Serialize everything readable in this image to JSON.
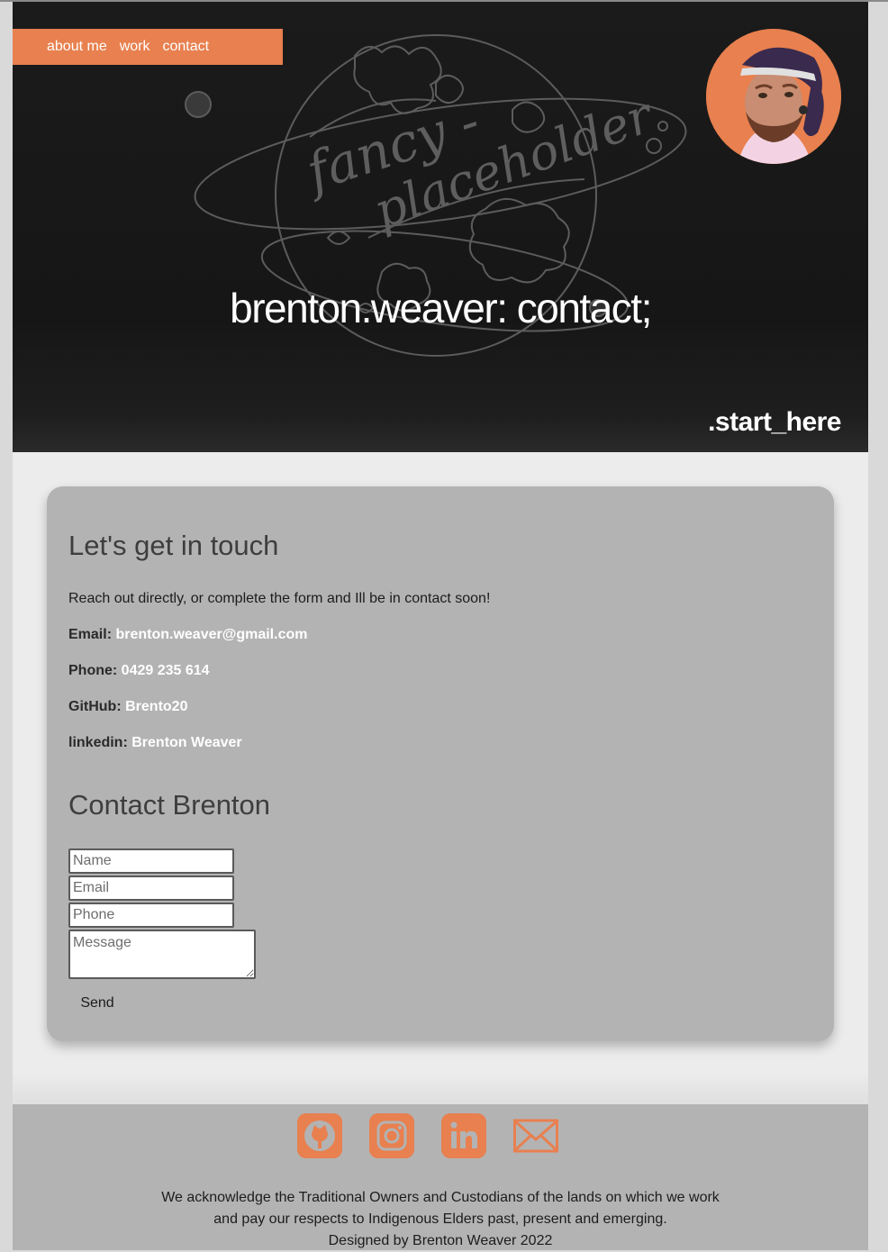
{
  "nav": {
    "items": [
      {
        "label": "about me"
      },
      {
        "label": "work"
      },
      {
        "label": "contact"
      }
    ]
  },
  "hero": {
    "title": "brenton.weaver: contact;",
    "art_text_line1": "fancy -",
    "art_text_line2": "placeholder",
    "cta": ".start_here"
  },
  "contact_info": {
    "heading": "Let's get in touch",
    "intro": "Reach out directly, or complete the form and Ill be in contact soon!",
    "email_label": "Email:",
    "email_value": "brenton.weaver@gmail.com",
    "phone_label": "Phone:",
    "phone_value": "0429 235 614",
    "github_label": "GitHub:",
    "github_value": "Brento20",
    "linkedin_label": "linkedin:",
    "linkedin_value": "Brenton Weaver"
  },
  "form": {
    "heading": "Contact Brenton",
    "name_placeholder": "Name",
    "email_placeholder": "Email",
    "phone_placeholder": "Phone",
    "message_placeholder": "Message",
    "send_label": "Send"
  },
  "footer": {
    "icons": [
      "github-icon",
      "instagram-icon",
      "linkedin-icon",
      "mail-icon"
    ],
    "ack_line1": "We acknowledge the Traditional Owners and Custodians of the lands on which we work",
    "ack_line2": "and pay our respects to Indigenous Elders past, present and emerging.",
    "credit": "Designed by Brenton Weaver 2022"
  },
  "colors": {
    "accent": "#e8804f",
    "hero_bg": "#1a1a1a",
    "card_bg": "#b3b3b3",
    "page_bg": "#ececec"
  }
}
